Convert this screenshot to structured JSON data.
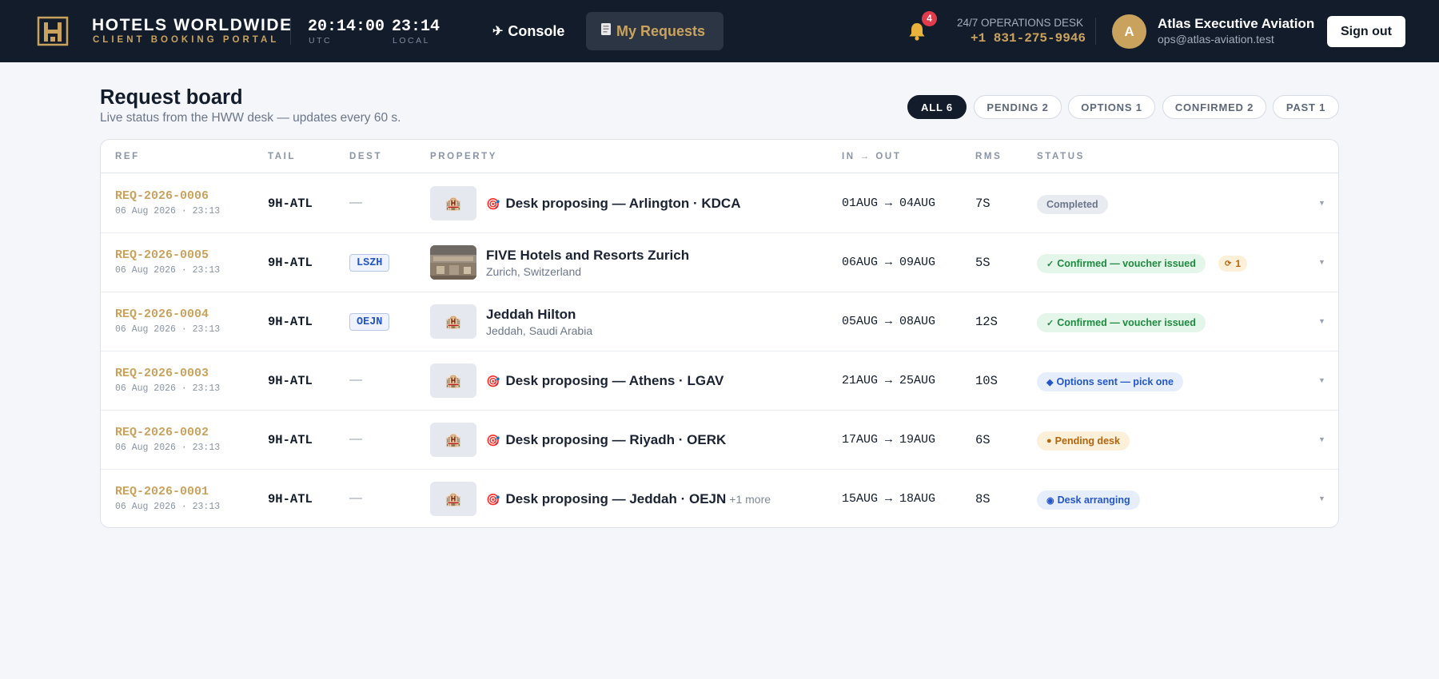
{
  "brand": {
    "title": "HOTELS WORLDWIDE",
    "subtitle": "CLIENT BOOKING PORTAL",
    "accent_color": "#c9a35d",
    "header_bg": "#131c2b"
  },
  "clocks": {
    "utc_time": "20:14:00",
    "utc_label": "UTC",
    "local_time": "23:14",
    "local_label": "LOCAL"
  },
  "nav": {
    "console": {
      "icon": "plane-icon",
      "label": "Console"
    },
    "requests": {
      "icon": "receipt-icon",
      "label": "My Requests"
    }
  },
  "notifications": {
    "icon": "bell-icon",
    "count": "4"
  },
  "ops": {
    "label": "24/7 OPERATIONS DESK",
    "phone": "+1 831-275-9946"
  },
  "account": {
    "avatar_initial": "A",
    "name": "Atlas Executive Aviation",
    "email": "ops@atlas-aviation.test",
    "signout_label": "Sign out"
  },
  "board": {
    "title": "Request board",
    "subtitle": "Live status from the HWW desk — updates every 60 s."
  },
  "filters": [
    {
      "label": "ALL 6",
      "active": true
    },
    {
      "label": "PENDING 2",
      "active": false
    },
    {
      "label": "OPTIONS 1",
      "active": false
    },
    {
      "label": "CONFIRMED 2",
      "active": false
    },
    {
      "label": "PAST 1",
      "active": false
    }
  ],
  "columns": {
    "ref": "REF",
    "tail": "TAIL",
    "dest": "DEST",
    "property": "PROPERTY",
    "in_out": "IN → OUT",
    "rms": "RMS",
    "status": "STATUS"
  },
  "rows": [
    {
      "ref": "REQ-2026-0006",
      "created": "06 Aug 2026 · 23:13",
      "tail": "9H-ATL",
      "dest": "—",
      "property": "Desk proposing — Arlington · KDCA",
      "more": "",
      "location": "",
      "dates": "01AUG → 04AUG",
      "rooms": "7S",
      "status": "Completed",
      "status_icon": "",
      "status_kind": "completed",
      "messages": ""
    },
    {
      "ref": "REQ-2026-0005",
      "created": "06 Aug 2026 · 23:13",
      "tail": "9H-ATL",
      "dest": "LSZH",
      "property": "FIVE Hotels and Resorts Zurich",
      "more": "",
      "location": "Zurich, Switzerland",
      "dates": "06AUG → 09AUG",
      "rooms": "5S",
      "status": "Confirmed — voucher issued",
      "status_icon": "✓",
      "status_kind": "confirmed",
      "messages": "1"
    },
    {
      "ref": "REQ-2026-0004",
      "created": "06 Aug 2026 · 23:13",
      "tail": "9H-ATL",
      "dest": "OEJN",
      "property": "Jeddah Hilton",
      "more": "",
      "location": "Jeddah, Saudi Arabia",
      "dates": "05AUG → 08AUG",
      "rooms": "12S",
      "status": "Confirmed — voucher issued",
      "status_icon": "✓",
      "status_kind": "confirmed",
      "messages": ""
    },
    {
      "ref": "REQ-2026-0003",
      "created": "06 Aug 2026 · 23:13",
      "tail": "9H-ATL",
      "dest": "—",
      "property": "Desk proposing — Athens · LGAV",
      "more": "",
      "location": "",
      "dates": "21AUG → 25AUG",
      "rooms": "10S",
      "status": "Options sent — pick one",
      "status_icon": "◆",
      "status_kind": "options",
      "messages": ""
    },
    {
      "ref": "REQ-2026-0002",
      "created": "06 Aug 2026 · 23:13",
      "tail": "9H-ATL",
      "dest": "—",
      "property": "Desk proposing — Riyadh · OERK",
      "more": "",
      "location": "",
      "dates": "17AUG → 19AUG",
      "rooms": "6S",
      "status": "Pending desk",
      "status_icon": "●",
      "status_kind": "pending",
      "messages": ""
    },
    {
      "ref": "REQ-2026-0001",
      "created": "06 Aug 2026 · 23:13",
      "tail": "9H-ATL",
      "dest": "—",
      "property": "Desk proposing — Jeddah · OEJN",
      "more": "+1 more",
      "location": "",
      "dates": "15AUG → 18AUG",
      "rooms": "8S",
      "status": "Desk arranging",
      "status_icon": "◉",
      "status_kind": "arranging",
      "messages": ""
    }
  ]
}
